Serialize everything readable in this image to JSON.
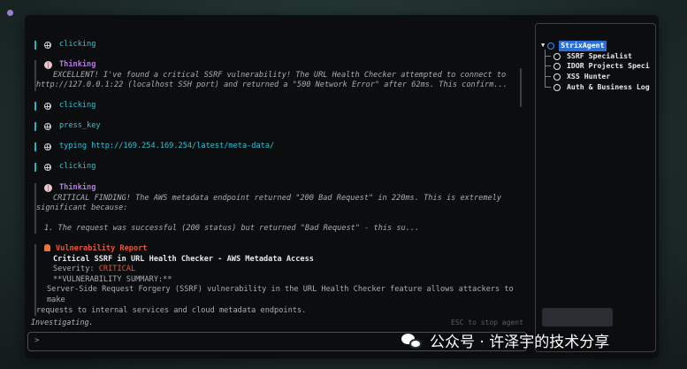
{
  "feed": {
    "e1": {
      "tool": "clicking"
    },
    "e2": {
      "label": "Thinking",
      "line1": "EXCELLENT! I've found a critical SSRF vulnerability! The URL Health Checker attempted to connect to",
      "line2": "http://127.0.0.1:22 (localhost SSH port) and returned a \"500 Network Error\" after 62ms. This confirm..."
    },
    "e3": {
      "tool": "clicking"
    },
    "e4": {
      "tool": "press_key"
    },
    "e5": {
      "tool": "typing http://169.254.169.254/latest/meta-data/"
    },
    "e6": {
      "tool": "clicking"
    },
    "e7": {
      "label": "Thinking",
      "line1": "CRITICAL FINDING! The AWS metadata endpoint returned \"200 Bad Request\" in 220ms. This is extremely",
      "line2": "significant because:",
      "line3": "1. The request was successful (200 status) but returned \"Bad Request\" - this su..."
    },
    "e8": {
      "label": "Vulnerability Report",
      "title": "Critical SSRF in URL Health Checker - AWS Metadata Access",
      "severity_label": "Severity: ",
      "severity_value": "CRITICAL",
      "summary": "**VULNERABILITY SUMMARY:**",
      "desc1": "Server-Side Request Forgery (SSRF) vulnerability in the URL Health Checker feature allows attackers to make",
      "desc2": "requests to internal services and cloud metadata endpoints."
    }
  },
  "status": {
    "text": "Investigating.",
    "hint": "ESC to stop agent"
  },
  "input": {
    "prompt": ">"
  },
  "agents": {
    "root": "StrixAgent",
    "children": [
      "SSRF Specialist",
      "IDOR Projects Speci",
      "XSS Hunter",
      "Auth & Business Log"
    ]
  },
  "watermark": {
    "text": "公众号 · 许泽宇的技术分享"
  },
  "colors": {
    "accent": "#22b3c9",
    "thinking": "#b77ae8",
    "critical": "#e8563c",
    "selected": "#2b6fd6"
  }
}
